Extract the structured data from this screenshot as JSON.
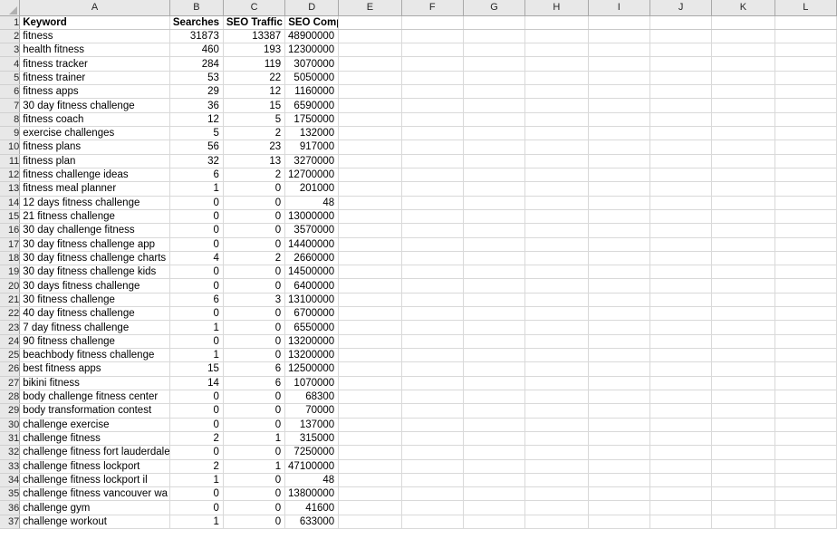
{
  "app": {
    "type": "spreadsheet",
    "select_all_icon": "select-all-triangle-icon"
  },
  "columns": {
    "letters": [
      "A",
      "B",
      "C",
      "D",
      "E",
      "F",
      "G",
      "H",
      "I",
      "J",
      "K",
      "L"
    ],
    "widths": [
      160,
      57,
      66,
      57,
      67,
      66,
      66,
      67,
      66,
      66,
      67,
      66
    ]
  },
  "header": {
    "keyword": "Keyword",
    "searches": "Searches",
    "seo_traffic": "SEO Traffic",
    "seo_comp": "SEO Comp"
  },
  "rows": [
    {
      "n": "1",
      "a": "Keyword",
      "b": "Searches",
      "c": "SEO Traffic",
      "d": "SEO Comp"
    },
    {
      "n": "2",
      "a": "fitness",
      "b": "31873",
      "c": "13387",
      "d": "48900000"
    },
    {
      "n": "3",
      "a": "health fitness",
      "b": "460",
      "c": "193",
      "d": "12300000"
    },
    {
      "n": "4",
      "a": "fitness tracker",
      "b": "284",
      "c": "119",
      "d": "3070000"
    },
    {
      "n": "5",
      "a": "fitness trainer",
      "b": "53",
      "c": "22",
      "d": "5050000"
    },
    {
      "n": "6",
      "a": "fitness apps",
      "b": "29",
      "c": "12",
      "d": "1160000"
    },
    {
      "n": "7",
      "a": "30 day fitness challenge",
      "b": "36",
      "c": "15",
      "d": "6590000"
    },
    {
      "n": "8",
      "a": "fitness coach",
      "b": "12",
      "c": "5",
      "d": "1750000"
    },
    {
      "n": "9",
      "a": "exercise challenges",
      "b": "5",
      "c": "2",
      "d": "132000"
    },
    {
      "n": "10",
      "a": "fitness plans",
      "b": "56",
      "c": "23",
      "d": "917000"
    },
    {
      "n": "11",
      "a": "fitness plan",
      "b": "32",
      "c": "13",
      "d": "3270000"
    },
    {
      "n": "12",
      "a": "fitness challenge ideas",
      "b": "6",
      "c": "2",
      "d": "12700000"
    },
    {
      "n": "13",
      "a": "fitness meal planner",
      "b": "1",
      "c": "0",
      "d": "201000"
    },
    {
      "n": "14",
      "a": "12 days fitness challenge",
      "b": "0",
      "c": "0",
      "d": "48"
    },
    {
      "n": "15",
      "a": "21 fitness challenge",
      "b": "0",
      "c": "0",
      "d": "13000000"
    },
    {
      "n": "16",
      "a": "30 day challenge fitness",
      "b": "0",
      "c": "0",
      "d": "3570000"
    },
    {
      "n": "17",
      "a": "30 day fitness challenge app",
      "b": "0",
      "c": "0",
      "d": "14400000"
    },
    {
      "n": "18",
      "a": "30 day fitness challenge charts",
      "b": "4",
      "c": "2",
      "d": "2660000"
    },
    {
      "n": "19",
      "a": "30 day fitness challenge kids",
      "b": "0",
      "c": "0",
      "d": "14500000"
    },
    {
      "n": "20",
      "a": "30 days fitness challenge",
      "b": "0",
      "c": "0",
      "d": "6400000"
    },
    {
      "n": "21",
      "a": "30 fitness challenge",
      "b": "6",
      "c": "3",
      "d": "13100000"
    },
    {
      "n": "22",
      "a": "40 day fitness challenge",
      "b": "0",
      "c": "0",
      "d": "6700000"
    },
    {
      "n": "23",
      "a": "7 day fitness challenge",
      "b": "1",
      "c": "0",
      "d": "6550000"
    },
    {
      "n": "24",
      "a": "90 fitness challenge",
      "b": "0",
      "c": "0",
      "d": "13200000"
    },
    {
      "n": "25",
      "a": "beachbody fitness challenge",
      "b": "1",
      "c": "0",
      "d": "13200000"
    },
    {
      "n": "26",
      "a": "best fitness apps",
      "b": "15",
      "c": "6",
      "d": "12500000"
    },
    {
      "n": "27",
      "a": "bikini fitness",
      "b": "14",
      "c": "6",
      "d": "1070000"
    },
    {
      "n": "28",
      "a": "body challenge fitness center",
      "b": "0",
      "c": "0",
      "d": "68300"
    },
    {
      "n": "29",
      "a": "body transformation contest",
      "b": "0",
      "c": "0",
      "d": "70000"
    },
    {
      "n": "30",
      "a": "challenge exercise",
      "b": "0",
      "c": "0",
      "d": "137000"
    },
    {
      "n": "31",
      "a": "challenge fitness",
      "b": "2",
      "c": "1",
      "d": "315000"
    },
    {
      "n": "32",
      "a": "challenge fitness fort lauderdale",
      "b": "0",
      "c": "0",
      "d": "7250000"
    },
    {
      "n": "33",
      "a": "challenge fitness lockport",
      "b": "2",
      "c": "1",
      "d": "47100000"
    },
    {
      "n": "34",
      "a": "challenge fitness lockport il",
      "b": "1",
      "c": "0",
      "d": "48"
    },
    {
      "n": "35",
      "a": "challenge fitness vancouver wa",
      "b": "0",
      "c": "0",
      "d": "13800000"
    },
    {
      "n": "36",
      "a": "challenge gym",
      "b": "0",
      "c": "0",
      "d": "41600"
    },
    {
      "n": "37",
      "a": "challenge workout",
      "b": "1",
      "c": "0",
      "d": "633000"
    }
  ],
  "colors": {
    "header_bg": "#e8e8e8",
    "header_border": "#a8a8a8",
    "gridline": "#d9d9d9",
    "cell_bg": "#ffffff",
    "text": "#000000"
  }
}
